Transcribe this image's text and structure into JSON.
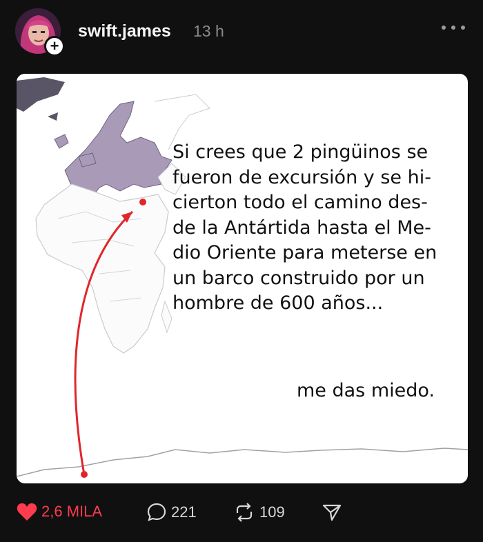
{
  "post": {
    "username": "swift.james",
    "timestamp": "13 h",
    "image_text": "Si crees que 2 pingüinos se\nfueron de excursión y se hi-\ncierton todo el camino des-\nde la Antártida hasta el Me-\ndio Oriente para meterse en\nun barco construido por un\nhombre de 600 años...",
    "image_text_end": "me das miedo."
  },
  "actions": {
    "likes": "2,6 MILA",
    "comments": "221",
    "reposts": "109"
  },
  "icons": {
    "avatar": "avatar-image",
    "follow": "plus-icon",
    "more": "more-dots-icon",
    "like": "heart-icon",
    "comment": "comment-icon",
    "repost": "repost-icon",
    "share": "send-icon"
  },
  "colors": {
    "background": "#101010",
    "like_red": "#ff3b4e",
    "europe_purple": "#a99bb8",
    "arrow_red": "#e0262b"
  }
}
